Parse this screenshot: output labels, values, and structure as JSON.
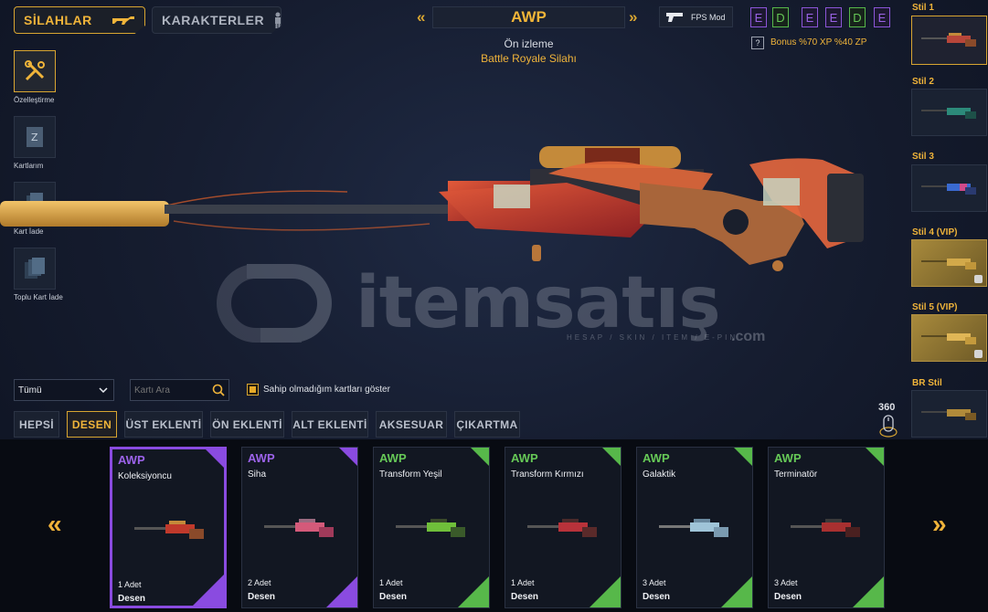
{
  "top_tabs": {
    "weapons": "SİLAHLAR",
    "characters": "KARAKTERLER"
  },
  "tools": [
    {
      "label": "Özelleştirme"
    },
    {
      "label": "Kartlarım"
    },
    {
      "label": "Kart İade"
    },
    {
      "label": "Toplu Kart İade"
    }
  ],
  "weapon": {
    "name": "AWP",
    "preview_label": "Ön izleme",
    "subtitle": "Battle Royale Silahı"
  },
  "mode_button": {
    "label": "FPS Mod"
  },
  "grades": [
    "E",
    "D",
    "E",
    "E",
    "D",
    "E"
  ],
  "bonus": {
    "help": "?",
    "text": "Bonus %70 XP %40 ZP"
  },
  "styles": [
    {
      "label": "Stil 1"
    },
    {
      "label": "Stil 2"
    },
    {
      "label": "Stil 3"
    },
    {
      "label": "Stil 4 (VIP)"
    },
    {
      "label": "Stil 5 (VIP)"
    },
    {
      "label": "BR Stil"
    }
  ],
  "filters": {
    "select_value": "Tümü",
    "search_placeholder": "Kartı Ara",
    "checkbox_label": "Sahip olmadığım kartları göster"
  },
  "category_tabs": [
    "HEPSİ",
    "DESEN",
    "ÜST EKLENTİ",
    "ÖN EKLENTİ",
    "ALT EKLENTİ",
    "AKSESUAR",
    "ÇIKARTMA"
  ],
  "rotate_label": "360",
  "watermark": {
    "brand": "itemsatış",
    "sub": "HESAP / SKIN / ITEM / E-PIN",
    "dot": ".com"
  },
  "cards": [
    {
      "weapon": "AWP",
      "name": "Koleksiyoncu",
      "count": "1 Adet",
      "type": "Desen",
      "rarity_color": "#8a4be0",
      "accent": "#c0392b"
    },
    {
      "weapon": "AWP",
      "name": "Siha",
      "count": "2 Adet",
      "type": "Desen",
      "rarity_color": "#8a4be0",
      "accent": "#d45a7a"
    },
    {
      "weapon": "AWP",
      "name": "Transform Yeşil",
      "count": "1 Adet",
      "type": "Desen",
      "rarity_color": "#57b84a",
      "accent": "#6fbf3a"
    },
    {
      "weapon": "AWP",
      "name": "Transform Kırmızı",
      "count": "1 Adet",
      "type": "Desen",
      "rarity_color": "#57b84a",
      "accent": "#b8323a"
    },
    {
      "weapon": "AWP",
      "name": "Galaktik",
      "count": "3 Adet",
      "type": "Desen",
      "rarity_color": "#57b84a",
      "accent": "#9fc4d8"
    },
    {
      "weapon": "AWP",
      "name": "Terminatör",
      "count": "3 Adet",
      "type": "Desen",
      "rarity_color": "#57b84a",
      "accent": "#a83030"
    }
  ]
}
